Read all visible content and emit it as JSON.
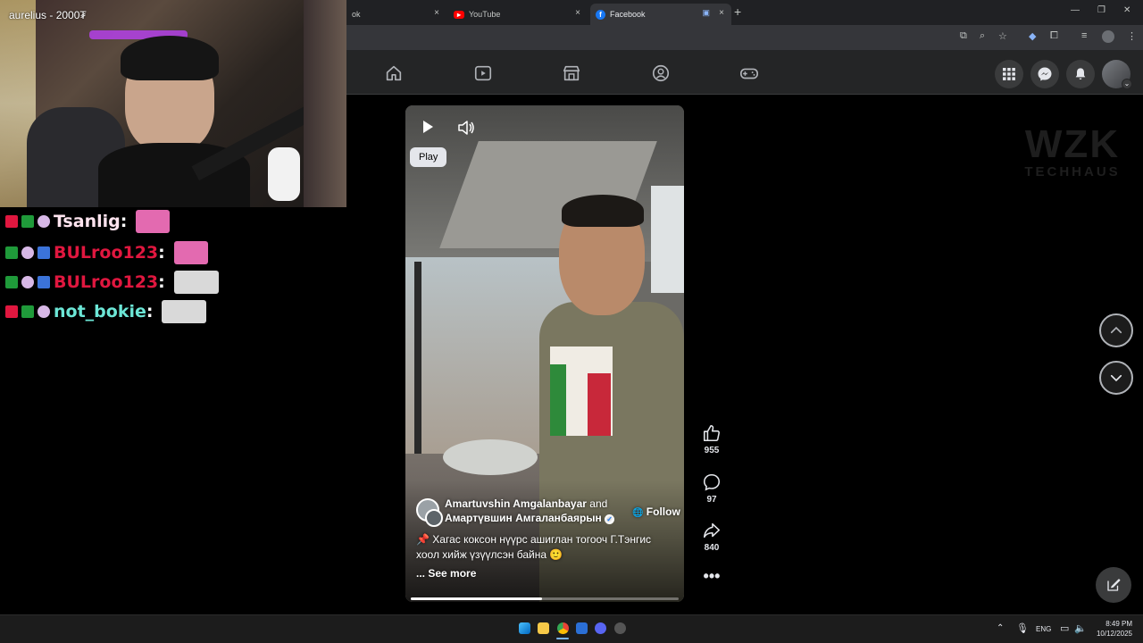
{
  "browser": {
    "tabs": [
      {
        "label": "ok",
        "close": "×"
      },
      {
        "label": "YouTube",
        "close": "×"
      },
      {
        "label": "Facebook",
        "close": "×"
      }
    ],
    "new_tab": "+"
  },
  "stream": {
    "streamer": "aurelius - 2000₮",
    "chat": [
      {
        "user": "Tsanlig",
        "color": "#ffe4ef"
      },
      {
        "user": "BULroo123",
        "color": "#e0173f"
      },
      {
        "user": "BULroo123",
        "color": "#e0173f"
      },
      {
        "user": "not_bokie",
        "color": "#6ce6d6"
      }
    ]
  },
  "reel": {
    "tooltip": "Play",
    "author1": "Amartuvshin Amgalanbayar",
    "and": "and",
    "author2": "Амартүвшин Амгаланбаярын",
    "follow": "Follow",
    "caption_line1": "Хагас коксон нүүрс ашиглан тогооч Г.Тэнгис",
    "caption_line2": "хоол хийж үзүүлсэн байна",
    "see_more": "... See more",
    "progress": 0.49
  },
  "actions": {
    "likes": "955",
    "comments": "97",
    "shares": "840"
  },
  "watermark": {
    "line1": "WZK",
    "line2": "TECHHAUS"
  },
  "taskbar": {
    "lang": "ENG",
    "time": "8:49 PM",
    "date": "10/12/2025"
  }
}
